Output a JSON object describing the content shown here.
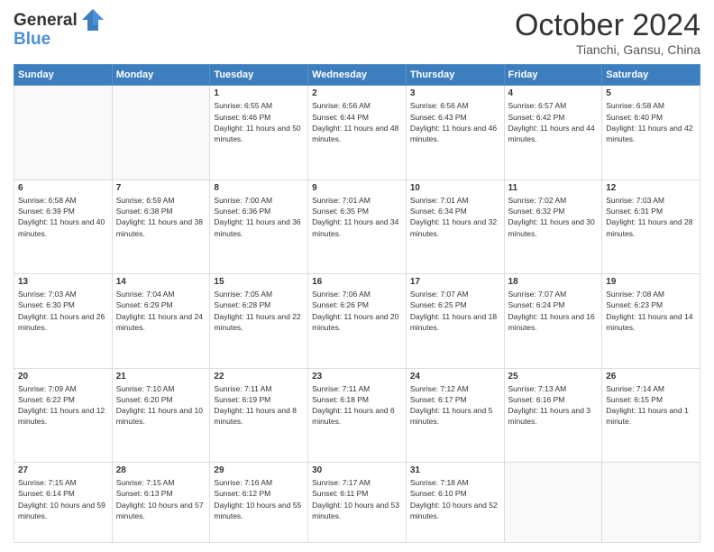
{
  "header": {
    "logo_line1": "General",
    "logo_line2": "Blue",
    "month": "October 2024",
    "location": "Tianchi, Gansu, China"
  },
  "days_of_week": [
    "Sunday",
    "Monday",
    "Tuesday",
    "Wednesday",
    "Thursday",
    "Friday",
    "Saturday"
  ],
  "weeks": [
    [
      {
        "num": "",
        "data": ""
      },
      {
        "num": "",
        "data": ""
      },
      {
        "num": "1",
        "data": "Sunrise: 6:55 AM\nSunset: 6:46 PM\nDaylight: 11 hours and 50 minutes."
      },
      {
        "num": "2",
        "data": "Sunrise: 6:56 AM\nSunset: 6:44 PM\nDaylight: 11 hours and 48 minutes."
      },
      {
        "num": "3",
        "data": "Sunrise: 6:56 AM\nSunset: 6:43 PM\nDaylight: 11 hours and 46 minutes."
      },
      {
        "num": "4",
        "data": "Sunrise: 6:57 AM\nSunset: 6:42 PM\nDaylight: 11 hours and 44 minutes."
      },
      {
        "num": "5",
        "data": "Sunrise: 6:58 AM\nSunset: 6:40 PM\nDaylight: 11 hours and 42 minutes."
      }
    ],
    [
      {
        "num": "6",
        "data": "Sunrise: 6:58 AM\nSunset: 6:39 PM\nDaylight: 11 hours and 40 minutes."
      },
      {
        "num": "7",
        "data": "Sunrise: 6:59 AM\nSunset: 6:38 PM\nDaylight: 11 hours and 38 minutes."
      },
      {
        "num": "8",
        "data": "Sunrise: 7:00 AM\nSunset: 6:36 PM\nDaylight: 11 hours and 36 minutes."
      },
      {
        "num": "9",
        "data": "Sunrise: 7:01 AM\nSunset: 6:35 PM\nDaylight: 11 hours and 34 minutes."
      },
      {
        "num": "10",
        "data": "Sunrise: 7:01 AM\nSunset: 6:34 PM\nDaylight: 11 hours and 32 minutes."
      },
      {
        "num": "11",
        "data": "Sunrise: 7:02 AM\nSunset: 6:32 PM\nDaylight: 11 hours and 30 minutes."
      },
      {
        "num": "12",
        "data": "Sunrise: 7:03 AM\nSunset: 6:31 PM\nDaylight: 11 hours and 28 minutes."
      }
    ],
    [
      {
        "num": "13",
        "data": "Sunrise: 7:03 AM\nSunset: 6:30 PM\nDaylight: 11 hours and 26 minutes."
      },
      {
        "num": "14",
        "data": "Sunrise: 7:04 AM\nSunset: 6:29 PM\nDaylight: 11 hours and 24 minutes."
      },
      {
        "num": "15",
        "data": "Sunrise: 7:05 AM\nSunset: 6:28 PM\nDaylight: 11 hours and 22 minutes."
      },
      {
        "num": "16",
        "data": "Sunrise: 7:06 AM\nSunset: 6:26 PM\nDaylight: 11 hours and 20 minutes."
      },
      {
        "num": "17",
        "data": "Sunrise: 7:07 AM\nSunset: 6:25 PM\nDaylight: 11 hours and 18 minutes."
      },
      {
        "num": "18",
        "data": "Sunrise: 7:07 AM\nSunset: 6:24 PM\nDaylight: 11 hours and 16 minutes."
      },
      {
        "num": "19",
        "data": "Sunrise: 7:08 AM\nSunset: 6:23 PM\nDaylight: 11 hours and 14 minutes."
      }
    ],
    [
      {
        "num": "20",
        "data": "Sunrise: 7:09 AM\nSunset: 6:22 PM\nDaylight: 11 hours and 12 minutes."
      },
      {
        "num": "21",
        "data": "Sunrise: 7:10 AM\nSunset: 6:20 PM\nDaylight: 11 hours and 10 minutes."
      },
      {
        "num": "22",
        "data": "Sunrise: 7:11 AM\nSunset: 6:19 PM\nDaylight: 11 hours and 8 minutes."
      },
      {
        "num": "23",
        "data": "Sunrise: 7:11 AM\nSunset: 6:18 PM\nDaylight: 11 hours and 6 minutes."
      },
      {
        "num": "24",
        "data": "Sunrise: 7:12 AM\nSunset: 6:17 PM\nDaylight: 11 hours and 5 minutes."
      },
      {
        "num": "25",
        "data": "Sunrise: 7:13 AM\nSunset: 6:16 PM\nDaylight: 11 hours and 3 minutes."
      },
      {
        "num": "26",
        "data": "Sunrise: 7:14 AM\nSunset: 6:15 PM\nDaylight: 11 hours and 1 minute."
      }
    ],
    [
      {
        "num": "27",
        "data": "Sunrise: 7:15 AM\nSunset: 6:14 PM\nDaylight: 10 hours and 59 minutes."
      },
      {
        "num": "28",
        "data": "Sunrise: 7:15 AM\nSunset: 6:13 PM\nDaylight: 10 hours and 57 minutes."
      },
      {
        "num": "29",
        "data": "Sunrise: 7:16 AM\nSunset: 6:12 PM\nDaylight: 10 hours and 55 minutes."
      },
      {
        "num": "30",
        "data": "Sunrise: 7:17 AM\nSunset: 6:11 PM\nDaylight: 10 hours and 53 minutes."
      },
      {
        "num": "31",
        "data": "Sunrise: 7:18 AM\nSunset: 6:10 PM\nDaylight: 10 hours and 52 minutes."
      },
      {
        "num": "",
        "data": ""
      },
      {
        "num": "",
        "data": ""
      }
    ]
  ]
}
